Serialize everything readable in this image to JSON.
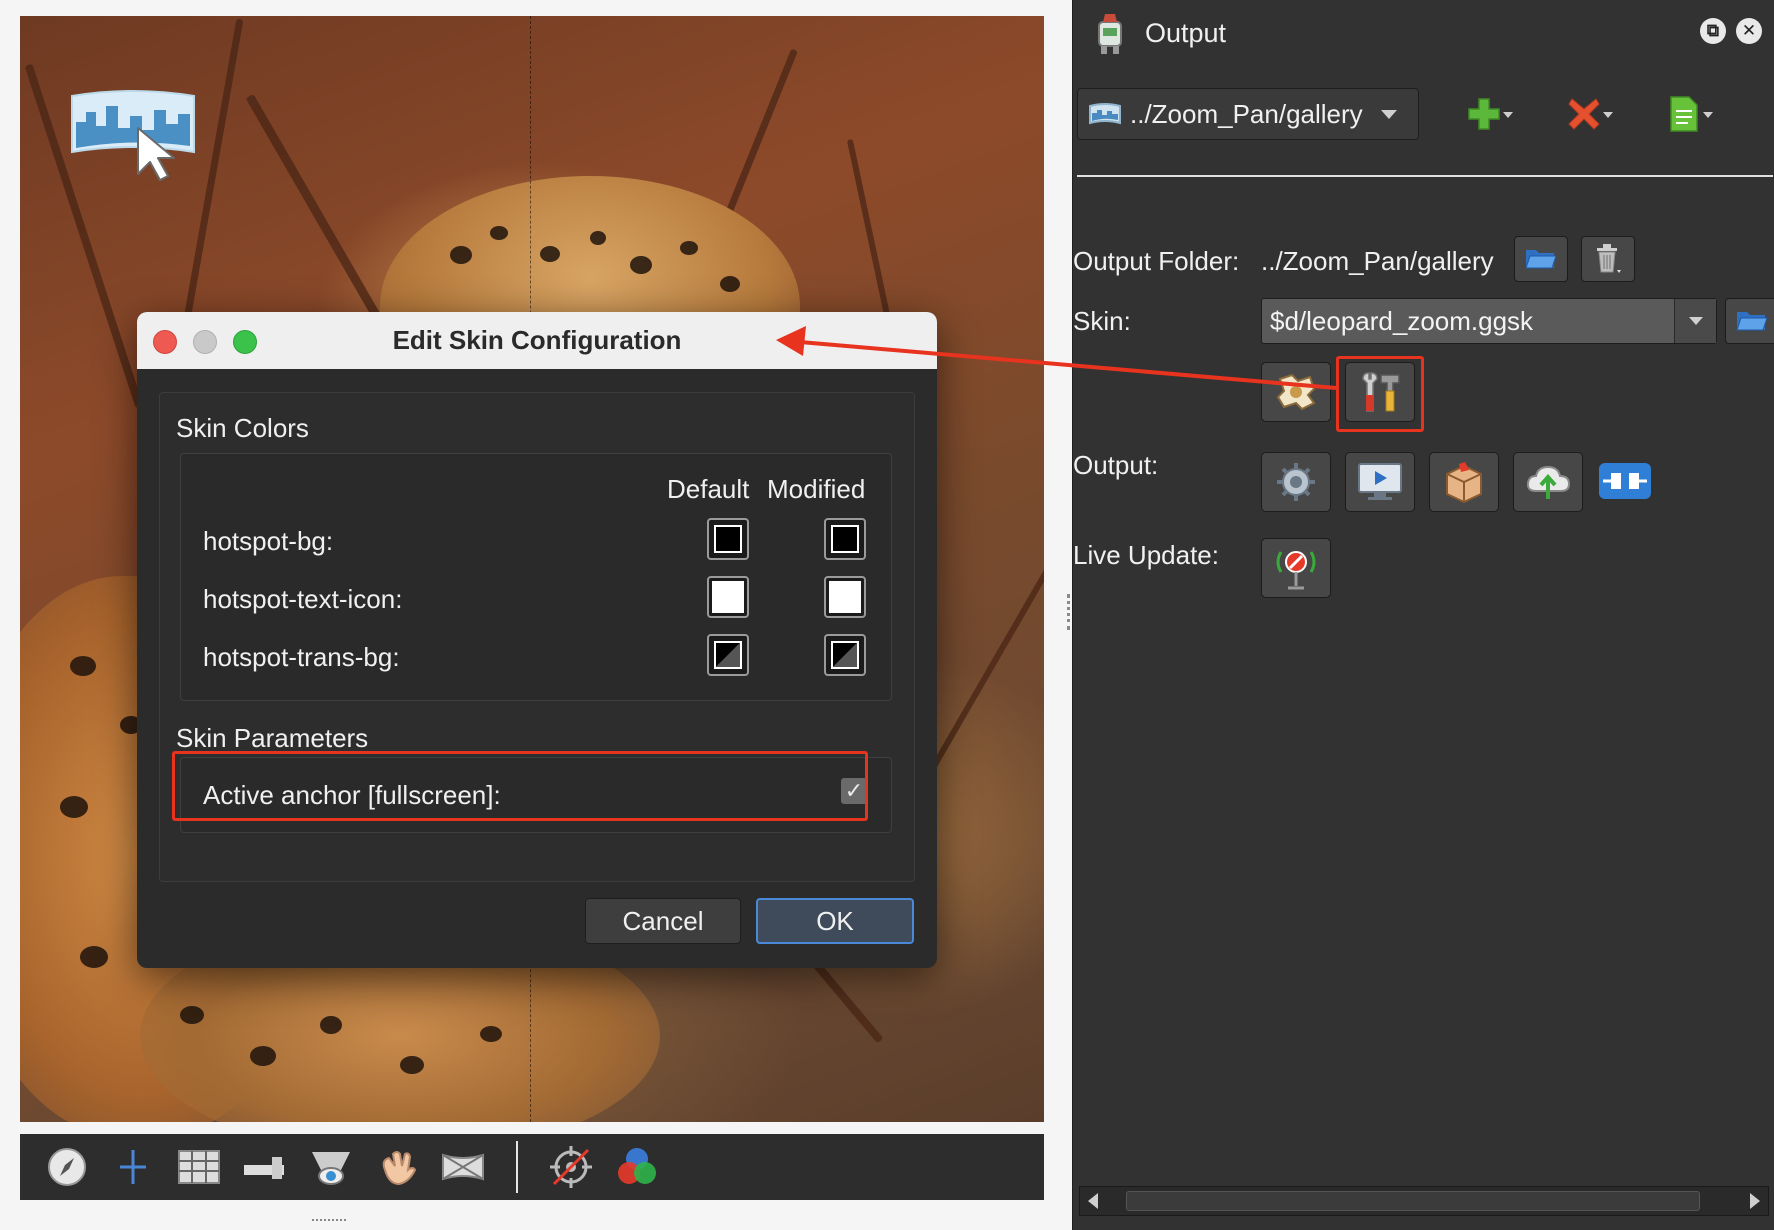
{
  "panel": {
    "title": "Output",
    "restore_icon": "⧉",
    "close_icon": "✕"
  },
  "preset": {
    "value": "../Zoom_Pan/gallery"
  },
  "output_folder": {
    "label": "Output Folder:",
    "value": "../Zoom_Pan/gallery"
  },
  "skin": {
    "label": "Skin:",
    "value": "$d/leopard_zoom.ggsk"
  },
  "output": {
    "label": "Output:"
  },
  "live_update": {
    "label": "Live Update:"
  },
  "dialog": {
    "title": "Edit Skin Configuration",
    "skin_colors_title": "Skin Colors",
    "col_default": "Default",
    "col_modified": "Modified",
    "rows": [
      {
        "name": "hotspot-bg:",
        "default": "#000000",
        "modified": "#000000"
      },
      {
        "name": "hotspot-text-icon:",
        "default": "#ffffff",
        "modified": "#ffffff"
      },
      {
        "name": "hotspot-trans-bg:",
        "default": "#000000",
        "modified": "#000000"
      }
    ],
    "skin_parameters_title": "Skin Parameters",
    "param_label": "Active anchor [fullscreen]:",
    "param_checked": true,
    "cancel": "Cancel",
    "ok": "OK"
  },
  "colors": {
    "panel_bg": "#323232",
    "accent_red": "#e8331f",
    "ok_border": "#4a88d8"
  }
}
